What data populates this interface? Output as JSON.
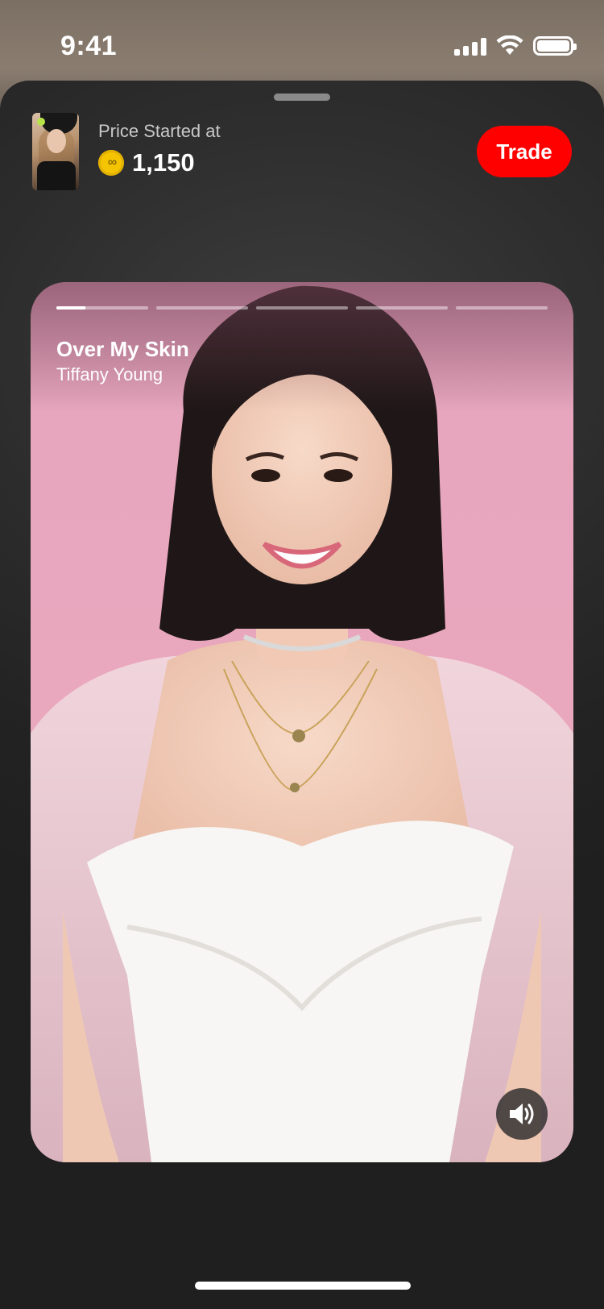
{
  "status_bar": {
    "time": "9:41",
    "icons": [
      "cellular-signal-icon",
      "wifi-icon",
      "battery-icon"
    ]
  },
  "header": {
    "price_label": "Price Started at",
    "price_value": "1,150",
    "coin_icon": "coin-icon",
    "trade_label": "Trade"
  },
  "story": {
    "title": "Over My Skin",
    "artist": "Tiffany Young",
    "segment_count": 5,
    "progress": [
      0.32,
      0,
      0,
      0,
      0
    ],
    "volume_icon": "speaker-icon"
  },
  "colors": {
    "accent": "#ff0000",
    "coin": "#f5c400",
    "sheet": "#2a2a2a",
    "card": "#e7a6bd"
  }
}
